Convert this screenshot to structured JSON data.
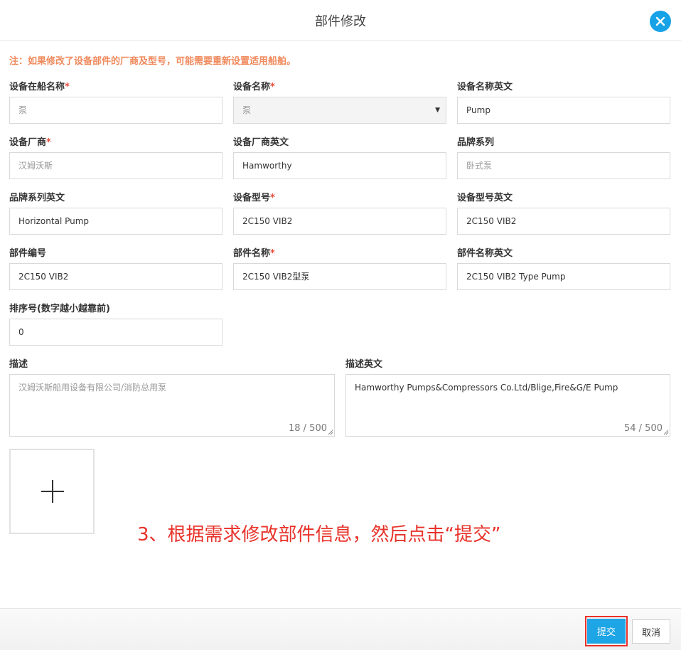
{
  "header": {
    "title": "部件修改"
  },
  "note": "注：如果修改了设备部件的厂商及型号，可能需要重新设置适用船舶。",
  "fields": {
    "ship_name": {
      "label": "设备在船名称",
      "required": "*",
      "value": "泵"
    },
    "equip_name": {
      "label": "设备名称",
      "required": "*",
      "value": "泵"
    },
    "equip_name_en": {
      "label": "设备名称英文",
      "value": "Pump"
    },
    "maker": {
      "label": "设备厂商",
      "required": "*",
      "value": "汉姆沃斯"
    },
    "maker_en": {
      "label": "设备厂商英文",
      "value": "Hamworthy"
    },
    "brand": {
      "label": "品牌系列",
      "value": "卧式泵"
    },
    "brand_en": {
      "label": "品牌系列英文",
      "value": "Horizontal Pump"
    },
    "model": {
      "label": "设备型号",
      "required": "*",
      "value": "2C150 VIB2"
    },
    "model_en": {
      "label": "设备型号英文",
      "value": "2C150 VIB2"
    },
    "part_no": {
      "label": "部件编号",
      "value": "2C150 VIB2"
    },
    "part_name": {
      "label": "部件名称",
      "required": "*",
      "value": "2C150 VIB2型泵"
    },
    "part_name_en": {
      "label": "部件名称英文",
      "value": "2C150 VIB2 Type Pump"
    },
    "sort": {
      "label": "排序号(数字越小越靠前)",
      "value": "0"
    },
    "desc": {
      "label": "描述",
      "value": "汉姆沃斯船用设备有限公司/消防总用泵",
      "counter": "18 / 500"
    },
    "desc_en": {
      "label": "描述英文",
      "value": "Hamworthy Pumps&Compressors Co.Ltd/Blige,Fire&G/E Pump",
      "counter": "54 / 500"
    }
  },
  "instruction": "3、根据需求修改部件信息，然后点击“提交”",
  "footer": {
    "submit": "提交",
    "cancel": "取消"
  },
  "colors": {
    "accent": "#1ea5e6",
    "warning": "#f08a5d",
    "required": "#e84d3d",
    "annotation": "#e8322a"
  }
}
